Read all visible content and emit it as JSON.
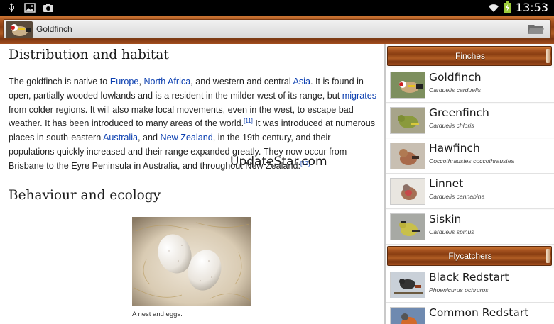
{
  "status_bar": {
    "time": "13:53"
  },
  "action_bar": {
    "title": "Goldfinch"
  },
  "article": {
    "section1": {
      "heading": "Distribution and habitat",
      "p1": "The goldfinch is native to ",
      "link_europe": "Europe",
      "p2": ", ",
      "link_north_africa": "North Africa",
      "p3": ", and western and central ",
      "link_asia": "Asia",
      "p4": ". It is found in open, partially wooded lowlands and is a resident in the milder west of its range, but ",
      "link_migrates": "migrates",
      "p5": " from colder regions. It will also make local movements, even in the west, to escape bad weather. It has been introduced to many areas of the world.",
      "ref11": "[11]",
      "p6": " It was introduced at numerous places in south-eastern ",
      "link_australia": "Australia",
      "p7": ", and ",
      "link_new_zealand": "New Zealand",
      "p8": ", in the 19th century, and their populations quickly increased and their range expanded greatly. They now occur from Brisbane to the Eyre Peninsula in Australia, and throughout New Zealand.",
      "ref12": "[12]"
    },
    "section2": {
      "heading": "Behaviour and ecology"
    },
    "image_caption": "A nest and eggs.",
    "watermark": "UpdateStar.com"
  },
  "panel": {
    "finches": {
      "header": "Finches",
      "items": [
        {
          "name": "Goldfinch",
          "latin": "Carduelis carduelis"
        },
        {
          "name": "Greenfinch",
          "latin": "Carduelis chloris"
        },
        {
          "name": "Hawfinch",
          "latin": "Coccothraustes coccothraustes"
        },
        {
          "name": "Linnet",
          "latin": "Carduelis cannabina"
        },
        {
          "name": "Siskin",
          "latin": "Carduelis spinus"
        }
      ]
    },
    "flycatchers": {
      "header": "Flycatchers",
      "items": [
        {
          "name": "Black Redstart",
          "latin": "Phoenicurus ochruros"
        },
        {
          "name": "Common Redstart",
          "latin": ""
        }
      ]
    }
  },
  "icons": {
    "usb": "usb-icon",
    "gallery": "gallery-icon",
    "camera": "camera-icon",
    "wifi": "wifi-icon",
    "battery": "battery-icon",
    "folder": "folder-icon"
  },
  "colors": {
    "link": "#0b3fb0",
    "wood": "#a85420"
  }
}
